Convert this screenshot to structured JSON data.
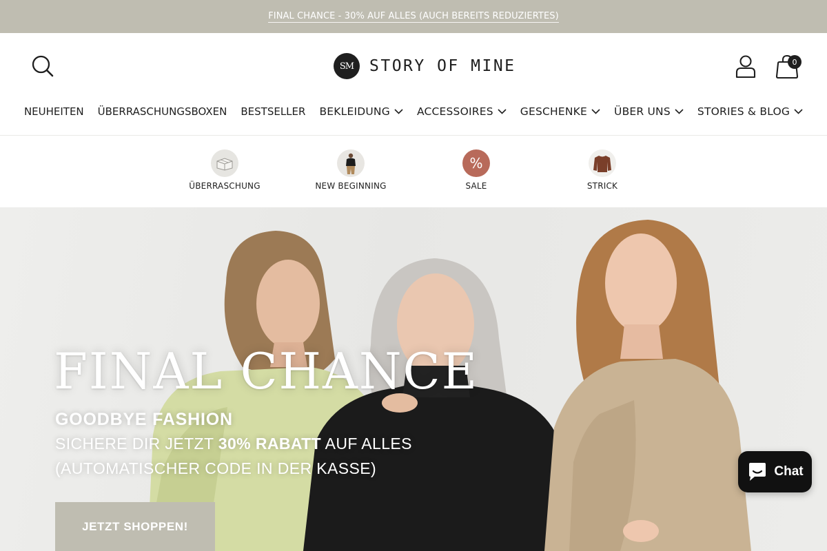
{
  "announcement": {
    "text": "FINAL CHANCE - 30% AUF ALLES (AUCH BEREITS REDUZIERTES)"
  },
  "header": {
    "logo_mark": "SM",
    "logo_text": "STORY OF MINE",
    "cart_count": "0",
    "icons": {
      "search": "search-icon",
      "account": "user-icon",
      "cart": "shopping-bag-icon"
    }
  },
  "nav": {
    "items": [
      {
        "label": "NEUHEITEN",
        "dropdown": false
      },
      {
        "label": "ÜBERRASCHUNGSBOXEN",
        "dropdown": false
      },
      {
        "label": "BESTSELLER",
        "dropdown": false
      },
      {
        "label": "BEKLEIDUNG",
        "dropdown": true
      },
      {
        "label": "ACCESSOIRES",
        "dropdown": true
      },
      {
        "label": "GESCHENKE",
        "dropdown": true
      },
      {
        "label": "ÜBER UNS",
        "dropdown": true
      },
      {
        "label": "STORIES & BLOG",
        "dropdown": true
      }
    ]
  },
  "categories": [
    {
      "label": "ÜBERRASCHUNG",
      "icon": "gift-box-icon"
    },
    {
      "label": "NEW BEGINNING",
      "icon": "model-thumbnail"
    },
    {
      "label": "SALE",
      "icon": "percent-icon",
      "glyph": "%"
    },
    {
      "label": "STRICK",
      "icon": "sweater-icon"
    }
  ],
  "hero": {
    "title": "FINAL CHANCE",
    "subtitle": "GOODBYE FASHION",
    "line2_pre": "SICHERE DIR JETZT ",
    "line2_bold": "30% RABATT",
    "line2_post": " AUF ALLES",
    "line3": "(AUTOMATISCHER CODE IN DER KASSE)",
    "cta": "JETZT SHOPPEN!"
  },
  "chat": {
    "label": "Chat",
    "icon": "chat-bubble-icon"
  },
  "colors": {
    "announcement_bg": "#bfbdb1",
    "cta_bg": "#bfbdb1",
    "text_dark": "#1e1e1e",
    "sale_circle": "#b86a5a",
    "chat_bg": "#111111"
  }
}
